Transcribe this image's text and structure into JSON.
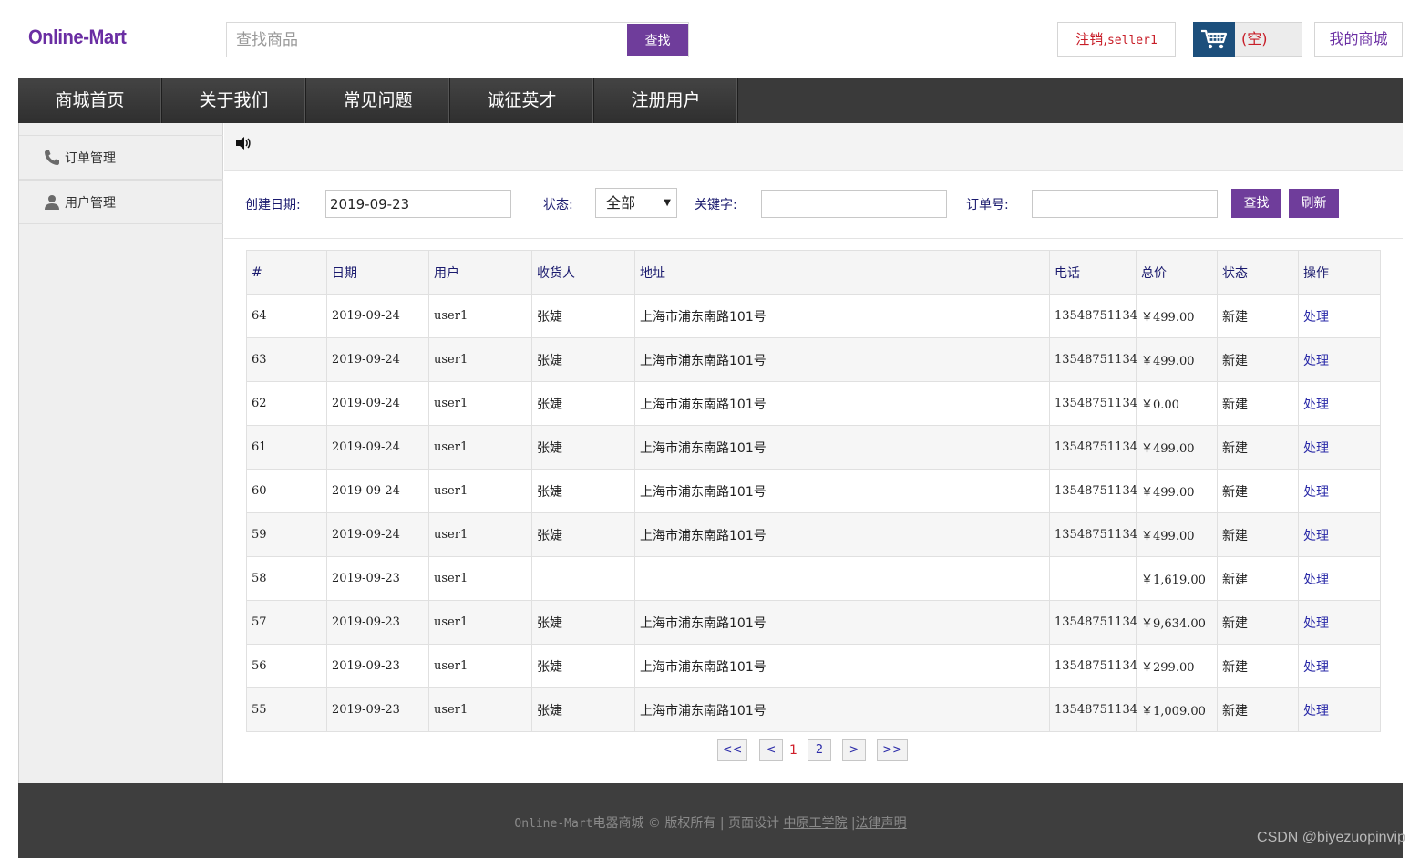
{
  "header": {
    "logo": "Online-Mart",
    "search_placeholder": "查找商品",
    "search_button": "查找",
    "logout_label": "注销,",
    "logout_user": "seller1",
    "cart_text": "(空)",
    "my_mall": "我的商城"
  },
  "nav": {
    "items": [
      "商城首页",
      "关于我们",
      "常见问题",
      "诚征英才",
      "注册用户"
    ]
  },
  "sidebar": {
    "items": [
      {
        "label": "订单管理",
        "icon": "phone-icon"
      },
      {
        "label": "用户管理",
        "icon": "user-icon"
      }
    ]
  },
  "filter": {
    "date_label": "创建日期:",
    "date_value": "2019-09-23",
    "status_label": "状态:",
    "status_value": "全部",
    "keyword_label": "关键字:",
    "keyword_value": "",
    "order_label": "订单号:",
    "order_value": "",
    "search_button": "查找",
    "refresh_button": "刷新"
  },
  "table": {
    "columns": [
      "#",
      "日期",
      "用户",
      "收货人",
      "地址",
      "电话",
      "总价",
      "状态",
      "操作"
    ],
    "rows": [
      {
        "id": "64",
        "date": "2019-09-24",
        "user": "user1",
        "receiver": "张婕",
        "address": "上海市浦东南路101号",
        "phone": "13548751134",
        "total": "￥499.00",
        "status": "新建",
        "action": "处理"
      },
      {
        "id": "63",
        "date": "2019-09-24",
        "user": "user1",
        "receiver": "张婕",
        "address": "上海市浦东南路101号",
        "phone": "13548751134",
        "total": "￥499.00",
        "status": "新建",
        "action": "处理"
      },
      {
        "id": "62",
        "date": "2019-09-24",
        "user": "user1",
        "receiver": "张婕",
        "address": "上海市浦东南路101号",
        "phone": "13548751134",
        "total": "￥0.00",
        "status": "新建",
        "action": "处理"
      },
      {
        "id": "61",
        "date": "2019-09-24",
        "user": "user1",
        "receiver": "张婕",
        "address": "上海市浦东南路101号",
        "phone": "13548751134",
        "total": "￥499.00",
        "status": "新建",
        "action": "处理"
      },
      {
        "id": "60",
        "date": "2019-09-24",
        "user": "user1",
        "receiver": "张婕",
        "address": "上海市浦东南路101号",
        "phone": "13548751134",
        "total": "￥499.00",
        "status": "新建",
        "action": "处理"
      },
      {
        "id": "59",
        "date": "2019-09-24",
        "user": "user1",
        "receiver": "张婕",
        "address": "上海市浦东南路101号",
        "phone": "13548751134",
        "total": "￥499.00",
        "status": "新建",
        "action": "处理"
      },
      {
        "id": "58",
        "date": "2019-09-23",
        "user": "user1",
        "receiver": "",
        "address": "",
        "phone": "",
        "total": "￥1,619.00",
        "status": "新建",
        "action": "处理"
      },
      {
        "id": "57",
        "date": "2019-09-23",
        "user": "user1",
        "receiver": "张婕",
        "address": "上海市浦东南路101号",
        "phone": "13548751134",
        "total": "￥9,634.00",
        "status": "新建",
        "action": "处理"
      },
      {
        "id": "56",
        "date": "2019-09-23",
        "user": "user1",
        "receiver": "张婕",
        "address": "上海市浦东南路101号",
        "phone": "13548751134",
        "total": "￥299.00",
        "status": "新建",
        "action": "处理"
      },
      {
        "id": "55",
        "date": "2019-09-23",
        "user": "user1",
        "receiver": "张婕",
        "address": "上海市浦东南路101号",
        "phone": "13548751134",
        "total": "￥1,009.00",
        "status": "新建",
        "action": "处理"
      }
    ]
  },
  "pager": {
    "first": "<<",
    "prev": "<",
    "current": "1",
    "next_page": "2",
    "next": ">",
    "last": ">>"
  },
  "footer": {
    "brand": "Online-Mart",
    "text1": "电器商城 © 版权所有 | 页面设计",
    "link1": "中原工学院",
    "sep": "|",
    "link2": "法律声明"
  },
  "watermark": "CSDN @biyezuopinvip",
  "colors": {
    "accent": "#6f3d9b",
    "nav_bg": "#3a3a3a",
    "cart_icon_bg": "#1c4f7c",
    "alert_red": "#c81e28",
    "link_blue": "#2a2aa8"
  }
}
